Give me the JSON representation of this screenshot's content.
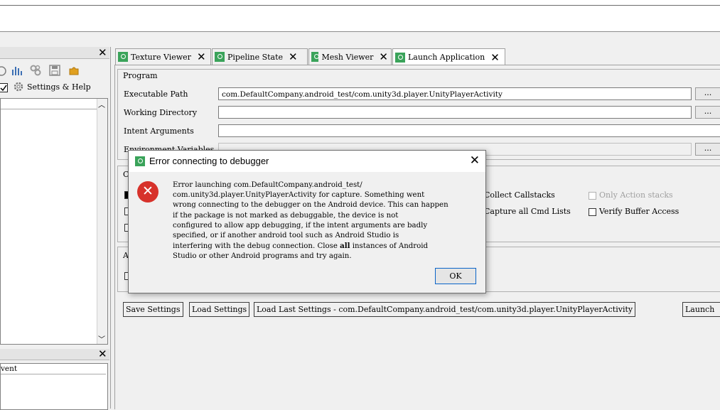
{
  "app": {
    "accent": "#3aa35a"
  },
  "left_panel": {
    "toolbar_icons": [
      "refresh-icon",
      "chart-icon",
      "gear-cluster-icon",
      "save-icon",
      "puzzle-icon"
    ],
    "settings_label": "Settings & Help",
    "event_column": "vent"
  },
  "tabs": [
    {
      "label": "Texture Viewer",
      "active": false
    },
    {
      "label": "Pipeline State",
      "active": false
    },
    {
      "label": "Mesh Viewer",
      "active": false
    },
    {
      "label": "Launch Application",
      "active": true
    }
  ],
  "program": {
    "group_label": "Program",
    "executable_label": "Executable Path",
    "executable_value": "com.DefaultCompany.android_test/com.unity3d.player.UnityPlayerActivity",
    "working_dir_label": "Working Directory",
    "working_dir_value": "",
    "intent_label": "Intent Arguments",
    "intent_value": "",
    "env_label": "Environment Variables",
    "browse_label": "..."
  },
  "capture_options": {
    "group_label_partial": "C",
    "collect_callstacks": "Collect Callstacks",
    "only_action_stacks": "Only Action stacks",
    "capture_cmd_lists": "Capture all Cmd Lists",
    "verify_buffer": "Verify Buffer Access"
  },
  "actions": {
    "group_label_partial": "A"
  },
  "buttons": {
    "save": "Save Settings",
    "load": "Load Settings",
    "load_last": "Load Last Settings - com.DefaultCompany.android_test/com.unity3d.player.UnityPlayerActivity",
    "launch": "Launch"
  },
  "dialog": {
    "title": "Error connecting to debugger",
    "message_pre": "Error launching com.DefaultCompany.android_test/\ncom.unity3d.player.UnityPlayerActivity for capture. Something went\nwrong connecting to the debugger on the Android device. This can happen\nif the package is not marked as debuggable, the device is not\nconfigured to allow app debugging, if the intent arguments are badly\nspecified, or if another android tool such as Android Studio is\ninterfering with the debug connection. Close ",
    "message_bold": "all",
    "message_post": " instances of Android\nStudio or other Android programs and try again.",
    "ok_label": "OK"
  }
}
